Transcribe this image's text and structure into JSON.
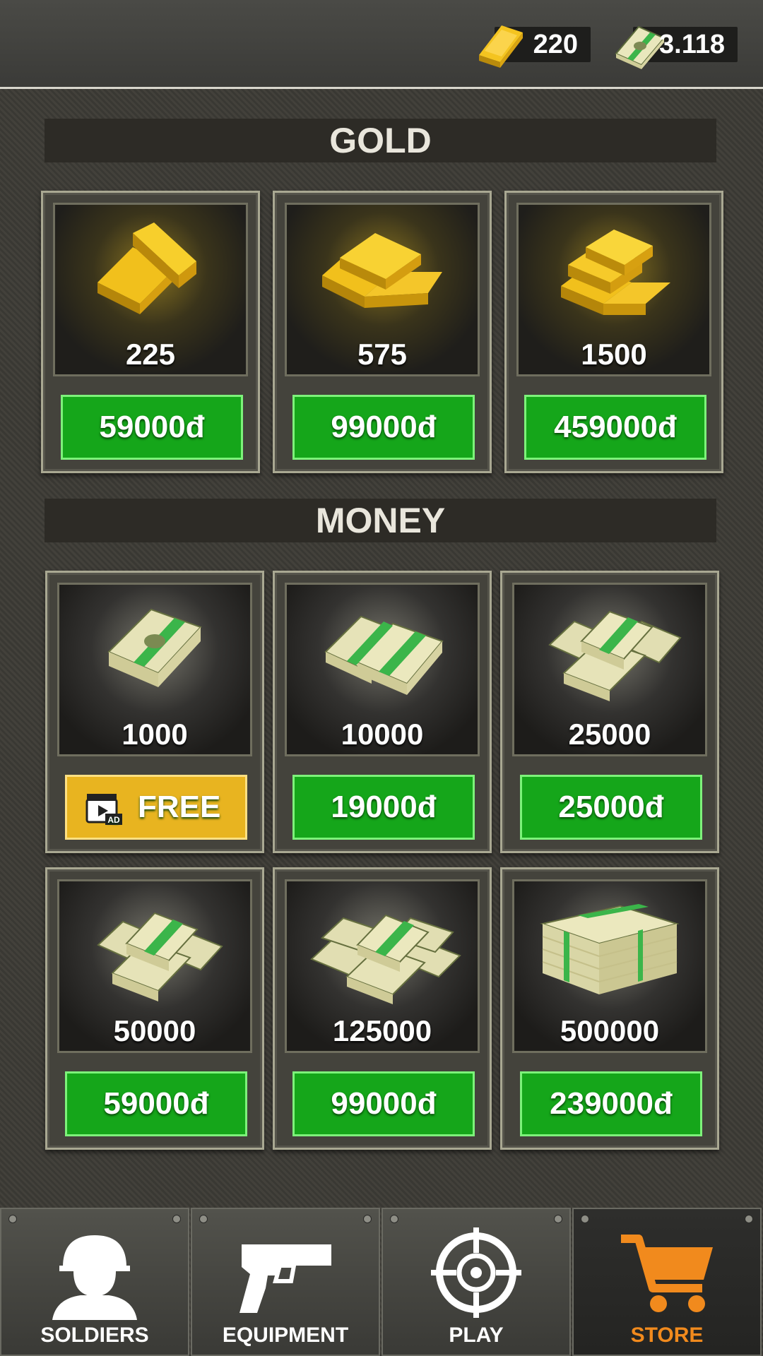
{
  "currency": {
    "gold": {
      "value": "220",
      "icon": "gold-bar-icon"
    },
    "money": {
      "value": "3.118",
      "icon": "cash-stack-icon"
    }
  },
  "sections": {
    "gold": {
      "title": "GOLD"
    },
    "money": {
      "title": "MONEY"
    }
  },
  "gold_items": [
    {
      "amount": "225",
      "price": "59000đ",
      "icon": "gold-bars-small-icon"
    },
    {
      "amount": "575",
      "price": "99000đ",
      "icon": "gold-bars-medium-icon"
    },
    {
      "amount": "1500",
      "price": "459000đ",
      "icon": "gold-bars-large-icon"
    }
  ],
  "money_items": [
    {
      "amount": "1000",
      "price": "FREE",
      "icon": "cash-stack-icon",
      "button_icon": "video-ad-icon"
    },
    {
      "amount": "10000",
      "price": "19000đ",
      "icon": "cash-stacks-icon"
    },
    {
      "amount": "25000",
      "price": "25000đ",
      "icon": "cash-pile-icon"
    },
    {
      "amount": "50000",
      "price": "59000đ",
      "icon": "cash-pile-icon"
    },
    {
      "amount": "125000",
      "price": "99000đ",
      "icon": "cash-heap-icon"
    },
    {
      "amount": "500000",
      "price": "239000đ",
      "icon": "cash-pallet-icon"
    }
  ],
  "ad_badge": "AD",
  "nav": [
    {
      "label": "SOLDIERS",
      "icon": "soldier-icon"
    },
    {
      "label": "EQUIPMENT",
      "icon": "pistol-icon"
    },
    {
      "label": "PLAY",
      "icon": "crosshair-icon"
    },
    {
      "label": "STORE",
      "icon": "cart-icon",
      "active": true
    }
  ],
  "colors": {
    "buy": "#15a61a",
    "free": "#e8b420",
    "active_tab": "#f18a1d"
  }
}
